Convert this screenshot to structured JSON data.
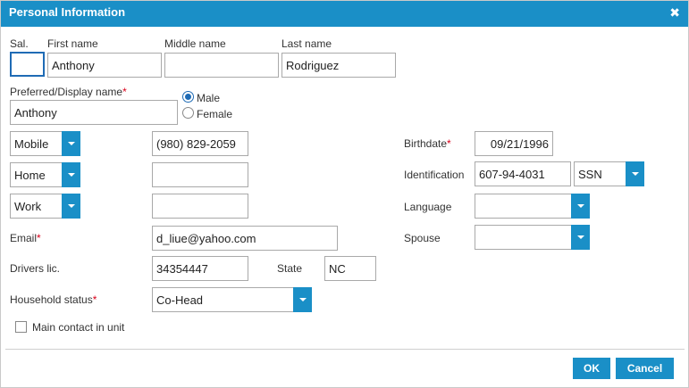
{
  "dialog": {
    "title": "Personal Information",
    "close_glyph": "✖"
  },
  "labels": {
    "sal": "Sal.",
    "first_name": "First name",
    "middle_name": "Middle name",
    "last_name": "Last name",
    "preferred_name": "Preferred/Display name",
    "male": "Male",
    "female": "Female",
    "birthdate": "Birthdate",
    "identification": "Identification",
    "language": "Language",
    "spouse": "Spouse",
    "email": "Email",
    "drivers_lic": "Drivers lic.",
    "state": "State",
    "household_status": "Household status",
    "main_contact": "Main contact in unit",
    "required_mark": "*"
  },
  "fields": {
    "sal": "",
    "first_name": "Anthony",
    "middle_name": "",
    "last_name": "Rodriguez",
    "preferred_name": "Anthony",
    "gender": "Male",
    "phone1_type": "Mobile",
    "phone1": "(980) 829-2059",
    "phone2_type": "Home",
    "phone2": "",
    "phone3_type": "Work",
    "phone3": "",
    "birthdate": "09/21/1996",
    "identification": "607-94-4031",
    "id_type": "SSN",
    "language": "",
    "spouse": "",
    "email": "d_liue@yahoo.com",
    "drivers_lic": "34354447",
    "state": "NC",
    "household_status": "Co-Head",
    "main_contact_checked": false
  },
  "buttons": {
    "ok": "OK",
    "cancel": "Cancel"
  },
  "colors": {
    "accent": "#1a8fc7",
    "required": "#d9001b",
    "focus": "#1f6bb5"
  }
}
